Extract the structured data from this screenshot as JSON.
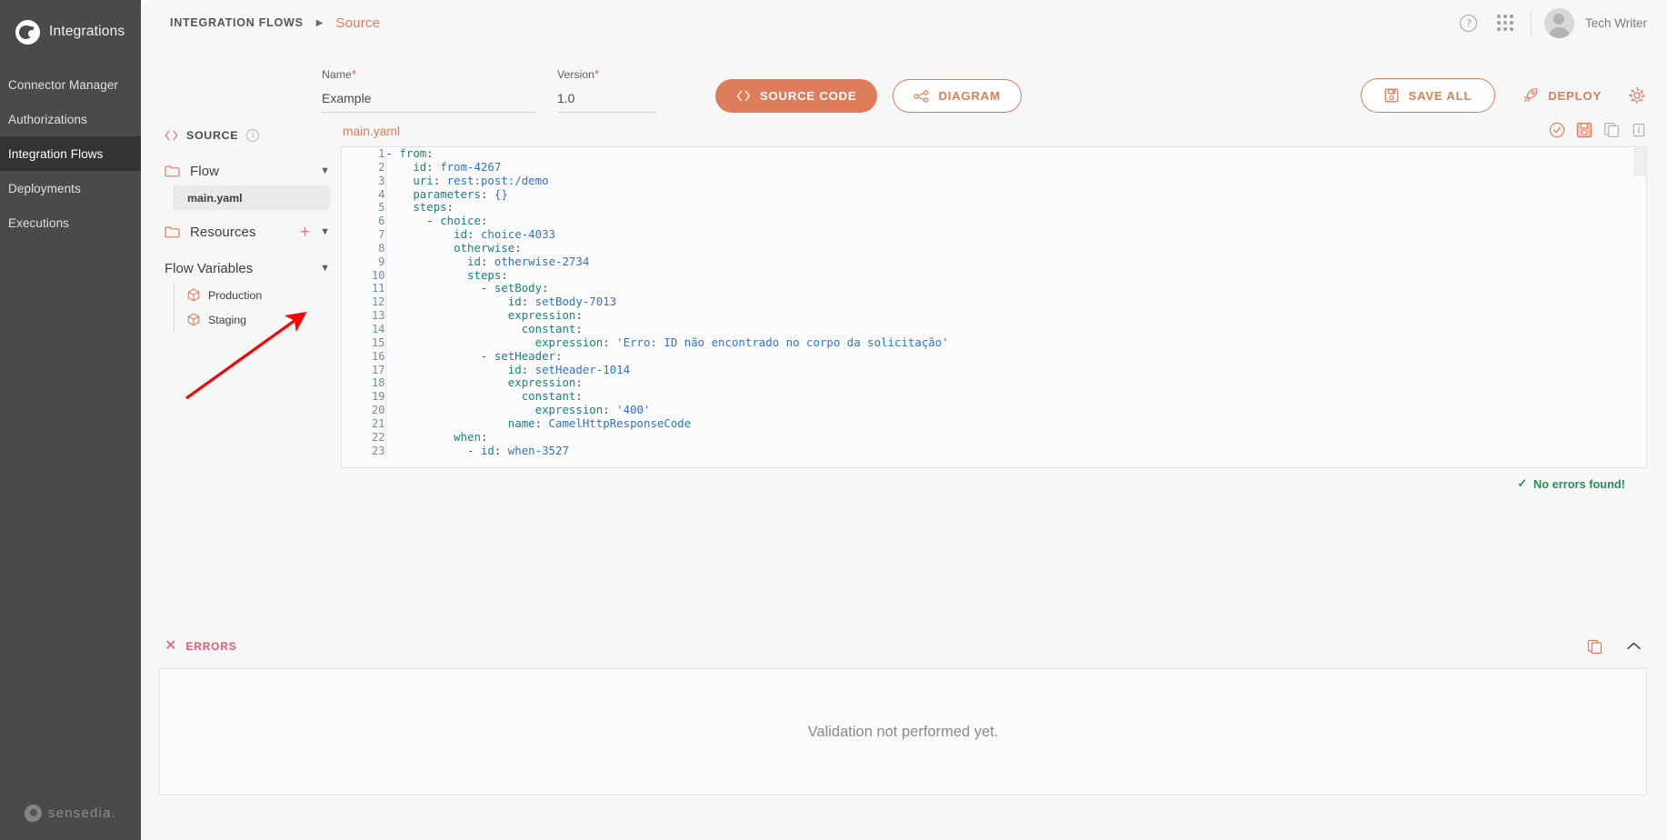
{
  "sidebar": {
    "brand": "Integrations",
    "brand_icon": "integrations-logo-icon",
    "items": [
      {
        "label": "Connector Manager",
        "active": false
      },
      {
        "label": "Authorizations",
        "active": false
      },
      {
        "label": "Integration Flows",
        "active": true
      },
      {
        "label": "Deployments",
        "active": false
      },
      {
        "label": "Executions",
        "active": false
      }
    ],
    "footer_logo_text": "sensedia."
  },
  "topbar": {
    "breadcrumb_root": "INTEGRATION FLOWS",
    "breadcrumb_sep": "▶",
    "breadcrumb_current": "Source",
    "help_icon": "help-circle-icon",
    "apps_icon": "app-grid-icon",
    "username": "Tech Writer"
  },
  "form": {
    "name_label": "Name",
    "name_value": "Example",
    "name_placeholder": "Name",
    "version_label": "Version",
    "version_value": "1.0",
    "version_placeholder": "Version",
    "required_mark": "*",
    "tab_source_code": "SOURCE CODE",
    "tab_diagram": "DIAGRAM"
  },
  "actions": {
    "save_all": "SAVE ALL",
    "deploy": "DEPLOY",
    "settings_icon": "gear-icon"
  },
  "tree": {
    "source_label": "SOURCE",
    "source_info_icon": "info-circle-icon",
    "flow_label": "Flow",
    "flow_files": [
      "main.yaml"
    ],
    "resources_label": "Resources",
    "resources_add": "+",
    "flow_variables_label": "Flow Variables",
    "flow_variables": [
      "Production",
      "Staging"
    ]
  },
  "editor": {
    "file_title": "main.yaml",
    "tools": [
      "validate-check-icon",
      "save-icon",
      "copy-icon",
      "delete-icon"
    ],
    "no_errors_text": "No errors found!",
    "no_errors_check": "✓",
    "lines": [
      {
        "n": 1,
        "segs": [
          {
            "t": "- ",
            "c": "p"
          },
          {
            "t": "from",
            "c": "k"
          },
          {
            "t": ":",
            "c": "p"
          }
        ]
      },
      {
        "n": 2,
        "segs": [
          {
            "t": "    ",
            "c": "p"
          },
          {
            "t": "id",
            "c": "k"
          },
          {
            "t": ": ",
            "c": "p"
          },
          {
            "t": "from-4267",
            "c": "v"
          }
        ]
      },
      {
        "n": 3,
        "segs": [
          {
            "t": "    ",
            "c": "p"
          },
          {
            "t": "uri",
            "c": "k"
          },
          {
            "t": ": ",
            "c": "p"
          },
          {
            "t": "rest:post:/demo",
            "c": "v"
          }
        ]
      },
      {
        "n": 4,
        "segs": [
          {
            "t": "    ",
            "c": "p"
          },
          {
            "t": "parameters",
            "c": "k"
          },
          {
            "t": ": ",
            "c": "p"
          },
          {
            "t": "{}",
            "c": "v"
          }
        ]
      },
      {
        "n": 5,
        "segs": [
          {
            "t": "    ",
            "c": "p"
          },
          {
            "t": "steps",
            "c": "k"
          },
          {
            "t": ":",
            "c": "p"
          }
        ]
      },
      {
        "n": 6,
        "segs": [
          {
            "t": "      - ",
            "c": "p"
          },
          {
            "t": "choice",
            "c": "k"
          },
          {
            "t": ":",
            "c": "p"
          }
        ]
      },
      {
        "n": 7,
        "segs": [
          {
            "t": "          ",
            "c": "p"
          },
          {
            "t": "id",
            "c": "k"
          },
          {
            "t": ": ",
            "c": "p"
          },
          {
            "t": "choice-4033",
            "c": "v"
          }
        ]
      },
      {
        "n": 8,
        "segs": [
          {
            "t": "          ",
            "c": "p"
          },
          {
            "t": "otherwise",
            "c": "k"
          },
          {
            "t": ":",
            "c": "p"
          }
        ]
      },
      {
        "n": 9,
        "segs": [
          {
            "t": "            ",
            "c": "p"
          },
          {
            "t": "id",
            "c": "k"
          },
          {
            "t": ": ",
            "c": "p"
          },
          {
            "t": "otherwise-2734",
            "c": "v"
          }
        ]
      },
      {
        "n": 10,
        "segs": [
          {
            "t": "            ",
            "c": "p"
          },
          {
            "t": "steps",
            "c": "k"
          },
          {
            "t": ":",
            "c": "p"
          }
        ]
      },
      {
        "n": 11,
        "segs": [
          {
            "t": "              - ",
            "c": "p"
          },
          {
            "t": "setBody",
            "c": "k"
          },
          {
            "t": ":",
            "c": "p"
          }
        ]
      },
      {
        "n": 12,
        "segs": [
          {
            "t": "                  ",
            "c": "p"
          },
          {
            "t": "id",
            "c": "k"
          },
          {
            "t": ": ",
            "c": "p"
          },
          {
            "t": "setBody-7013",
            "c": "v"
          }
        ]
      },
      {
        "n": 13,
        "segs": [
          {
            "t": "                  ",
            "c": "p"
          },
          {
            "t": "expression",
            "c": "k"
          },
          {
            "t": ":",
            "c": "p"
          }
        ]
      },
      {
        "n": 14,
        "segs": [
          {
            "t": "                    ",
            "c": "p"
          },
          {
            "t": "constant",
            "c": "k"
          },
          {
            "t": ":",
            "c": "p"
          }
        ]
      },
      {
        "n": 15,
        "segs": [
          {
            "t": "                      ",
            "c": "p"
          },
          {
            "t": "expression",
            "c": "k"
          },
          {
            "t": ": ",
            "c": "p"
          },
          {
            "t": "'Erro: ID não encontrado no corpo da solicitação'",
            "c": "s"
          }
        ]
      },
      {
        "n": 16,
        "segs": [
          {
            "t": "              - ",
            "c": "p"
          },
          {
            "t": "setHeader",
            "c": "k"
          },
          {
            "t": ":",
            "c": "p"
          }
        ]
      },
      {
        "n": 17,
        "segs": [
          {
            "t": "                  ",
            "c": "p"
          },
          {
            "t": "id",
            "c": "k"
          },
          {
            "t": ": ",
            "c": "p"
          },
          {
            "t": "setHeader-1014",
            "c": "v"
          }
        ]
      },
      {
        "n": 18,
        "segs": [
          {
            "t": "                  ",
            "c": "p"
          },
          {
            "t": "expression",
            "c": "k"
          },
          {
            "t": ":",
            "c": "p"
          }
        ]
      },
      {
        "n": 19,
        "segs": [
          {
            "t": "                    ",
            "c": "p"
          },
          {
            "t": "constant",
            "c": "k"
          },
          {
            "t": ":",
            "c": "p"
          }
        ]
      },
      {
        "n": 20,
        "segs": [
          {
            "t": "                      ",
            "c": "p"
          },
          {
            "t": "expression",
            "c": "k"
          },
          {
            "t": ": ",
            "c": "p"
          },
          {
            "t": "'400'",
            "c": "s"
          }
        ]
      },
      {
        "n": 21,
        "segs": [
          {
            "t": "                  ",
            "c": "p"
          },
          {
            "t": "name",
            "c": "k"
          },
          {
            "t": ": ",
            "c": "p"
          },
          {
            "t": "CamelHttpResponseCode",
            "c": "v"
          }
        ]
      },
      {
        "n": 22,
        "segs": [
          {
            "t": "          ",
            "c": "p"
          },
          {
            "t": "when",
            "c": "k"
          },
          {
            "t": ":",
            "c": "p"
          }
        ]
      },
      {
        "n": 23,
        "segs": [
          {
            "t": "            - ",
            "c": "p"
          },
          {
            "t": "id",
            "c": "k"
          },
          {
            "t": ": ",
            "c": "p"
          },
          {
            "t": "when-3527",
            "c": "v"
          }
        ]
      }
    ]
  },
  "errors": {
    "title": "ERRORS",
    "close_icon": "x-icon",
    "copy_icon": "copy-icon",
    "collapse_icon": "chevron-up-icon",
    "message": "Validation not performed yet."
  },
  "colors": {
    "accent": "#dd7d5c",
    "sidebar_bg": "#4a4a4a",
    "sidebar_active": "#333333",
    "error_red": "#ef5472",
    "success_green": "#2e8b57",
    "annotation_red": "#ff0000",
    "yaml_key": "#1c7f7f",
    "yaml_value": "#3173c4",
    "line_number": "#6a8fab"
  },
  "annotation": {
    "shape": "red-arrow",
    "direction": "up-right"
  }
}
